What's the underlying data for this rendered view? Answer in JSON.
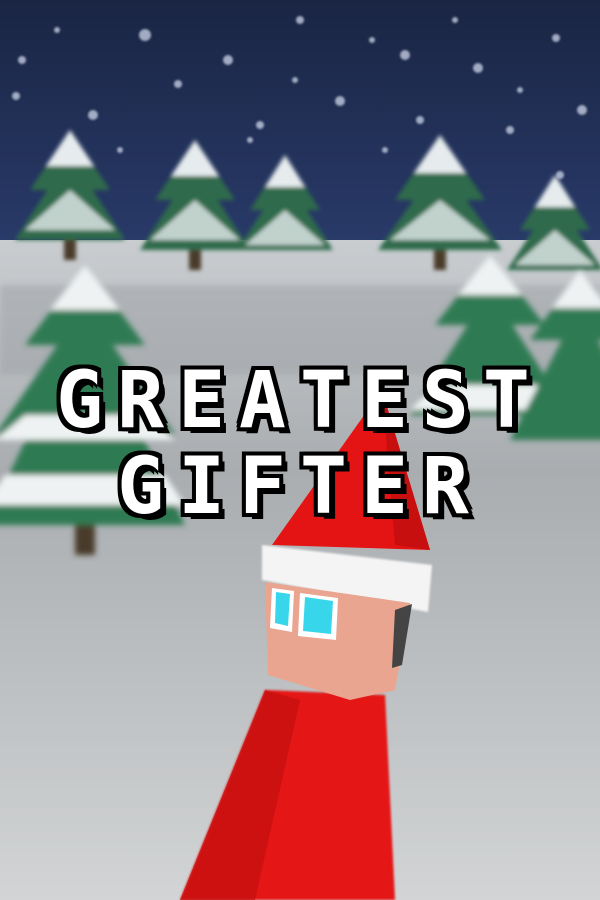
{
  "title": {
    "line1": "GREATEST",
    "line2": "GIFTER"
  },
  "colors": {
    "sky": "#1c2a4e",
    "snow": "#d9dde0",
    "tree": "#2f7a52",
    "suit": "#e01515",
    "skin": "#e9a58f",
    "eyes": "#38d6ea"
  }
}
